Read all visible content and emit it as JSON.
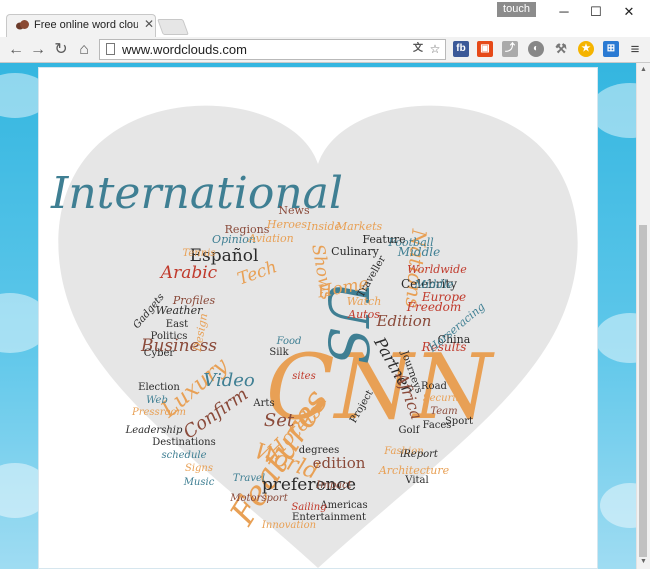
{
  "browser": {
    "tab_title": "Free online word cloud g",
    "profile_name": "touch",
    "url": "www.wordclouds.com",
    "window_buttons": [
      "minimize-icon",
      "maximize-icon",
      "close-icon"
    ],
    "extensions": {
      "fb_label": "fb",
      "list": [
        "translate-icon",
        "star-icon",
        "facebook-icon",
        "office-icon",
        "share-icon",
        "compass-icon",
        "tools-icon",
        "badge-icon",
        "extension-icon",
        "menu-icon"
      ]
    }
  },
  "word_cloud": {
    "shape": "heart",
    "colors": {
      "teal": "#3f7f93",
      "orange": "#e8a055",
      "red": "#c0392b",
      "dark": "#2b2b2b",
      "brown": "#8a4a3a",
      "shape_fill": "#e6e6e6"
    },
    "words": [
      {
        "text": "International",
        "color": "teal"
      },
      {
        "text": "CNN",
        "color": "orange"
      },
      {
        "text": "Features",
        "color": "orange"
      },
      {
        "text": "Business",
        "color": "brown"
      },
      {
        "text": "Luxury",
        "color": "orange"
      },
      {
        "text": "Confirm",
        "color": "brown"
      },
      {
        "text": "Video",
        "color": "teal"
      },
      {
        "text": "Hotels",
        "color": "orange"
      },
      {
        "text": "World",
        "color": "orange"
      },
      {
        "text": "Set",
        "color": "brown"
      },
      {
        "text": "edition",
        "color": "brown"
      },
      {
        "text": "preference",
        "color": "dark"
      },
      {
        "text": "Español",
        "color": "dark"
      },
      {
        "text": "Arabic",
        "color": "red"
      },
      {
        "text": "Tech",
        "color": "orange"
      },
      {
        "text": "Shows",
        "color": "orange"
      },
      {
        "text": "US",
        "color": "teal"
      },
      {
        "text": "Home",
        "color": "orange"
      },
      {
        "text": "Nations",
        "color": "orange"
      },
      {
        "text": "Edition",
        "color": "brown"
      },
      {
        "text": "Partner",
        "color": "dark"
      },
      {
        "text": "Africa",
        "color": "brown"
      },
      {
        "text": "Results",
        "color": "red"
      },
      {
        "text": "Europe",
        "color": "red"
      },
      {
        "text": "Freedom",
        "color": "red"
      },
      {
        "text": "Worldwide",
        "color": "red"
      },
      {
        "text": "Celebrity",
        "color": "dark"
      },
      {
        "text": "Middle",
        "color": "teal"
      },
      {
        "text": "Football",
        "color": "teal"
      },
      {
        "text": "Culinary",
        "color": "dark"
      },
      {
        "text": "Feature",
        "color": "dark"
      },
      {
        "text": "Markets",
        "color": "orange"
      },
      {
        "text": "Inside",
        "color": "orange"
      },
      {
        "text": "Regions",
        "color": "brown"
      },
      {
        "text": "Heroes",
        "color": "orange"
      },
      {
        "text": "News",
        "color": "brown"
      },
      {
        "text": "Opinion",
        "color": "teal"
      },
      {
        "text": "Aviation",
        "color": "orange"
      },
      {
        "text": "Tennis",
        "color": "orange"
      },
      {
        "text": "Profiles",
        "color": "brown"
      },
      {
        "text": "Weather",
        "color": "dark"
      },
      {
        "text": "East",
        "color": "dark"
      },
      {
        "text": "Politics",
        "color": "dark"
      },
      {
        "text": "Cyber",
        "color": "dark"
      },
      {
        "text": "Design",
        "color": "orange"
      },
      {
        "text": "Silk",
        "color": "dark"
      },
      {
        "text": "Food",
        "color": "teal"
      },
      {
        "text": "Watch",
        "color": "orange"
      },
      {
        "text": "Autos",
        "color": "red"
      },
      {
        "text": "China",
        "color": "dark"
      },
      {
        "text": "Horseracing",
        "color": "teal"
      },
      {
        "text": "Election",
        "color": "dark"
      },
      {
        "text": "Web",
        "color": "teal"
      },
      {
        "text": "Pressroom",
        "color": "orange"
      },
      {
        "text": "Leadership",
        "color": "dark"
      },
      {
        "text": "Destinations",
        "color": "dark"
      },
      {
        "text": "schedule",
        "color": "teal"
      },
      {
        "text": "Signs",
        "color": "orange"
      },
      {
        "text": "Music",
        "color": "teal"
      },
      {
        "text": "Travel",
        "color": "teal"
      },
      {
        "text": "Arts",
        "color": "dark"
      },
      {
        "text": "sites",
        "color": "red"
      },
      {
        "text": "Road",
        "color": "dark"
      },
      {
        "text": "Security",
        "color": "orange"
      },
      {
        "text": "Team",
        "color": "brown"
      },
      {
        "text": "Sport",
        "color": "dark"
      },
      {
        "text": "Faces",
        "color": "dark"
      },
      {
        "text": "Golf",
        "color": "dark"
      },
      {
        "text": "Fashion",
        "color": "orange"
      },
      {
        "text": "Architecture",
        "color": "orange"
      },
      {
        "text": "iReport",
        "color": "dark"
      },
      {
        "text": "Vital",
        "color": "dark"
      },
      {
        "text": "Impact",
        "color": "brown"
      },
      {
        "text": "Americas",
        "color": "dark"
      },
      {
        "text": "Sailing",
        "color": "red"
      },
      {
        "text": "Entertainment",
        "color": "dark"
      },
      {
        "text": "Motorsport",
        "color": "brown"
      },
      {
        "text": "Innovation",
        "color": "orange"
      },
      {
        "text": "degrees",
        "color": "dark"
      },
      {
        "text": "Project",
        "color": "dark"
      },
      {
        "text": "Traveller",
        "color": "dark"
      },
      {
        "text": "Journeys",
        "color": "dark"
      },
      {
        "text": "Gadgets",
        "color": "dark"
      },
      {
        "text": "Middle",
        "color": "teal"
      }
    ]
  }
}
